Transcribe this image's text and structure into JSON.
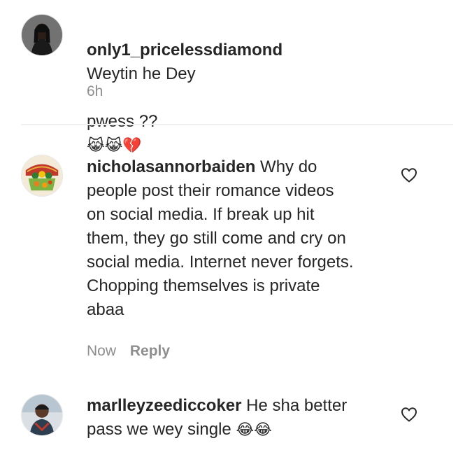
{
  "comments": [
    {
      "username": "only1_pricelessdiamond",
      "text_line1": "Weytin he Dey",
      "text_line2": "pwess ??",
      "emojis": "😹😹💔",
      "time": "6h",
      "reply_label": ""
    },
    {
      "username": "nicholasannorbaiden",
      "text": " Why do\npeople post their romance videos\non social media. If break up hit\nthem, they go still come and cry on\nsocial media. Internet never forgets.\nChopping themselves is private\nabaa",
      "time": "Now",
      "reply_label": "Reply"
    },
    {
      "username": "marlleyzeediccoker",
      "text": " He sha better\npass we wey single ",
      "emojis": "😂😂"
    }
  ],
  "icons": {
    "like": "heart-outline-icon"
  },
  "colors": {
    "text": "#262626",
    "meta": "#8e8e8e",
    "divider": "#efefef"
  }
}
